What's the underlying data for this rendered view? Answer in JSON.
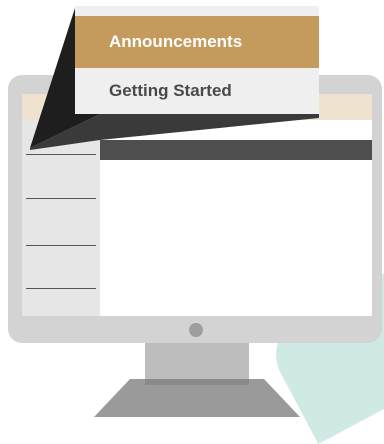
{
  "menu": {
    "items": [
      {
        "label": "Announcements",
        "active": true
      },
      {
        "label": "Getting Started",
        "active": false
      }
    ]
  },
  "colors": {
    "accent": "#c49a5d",
    "menu_bg": "#efefef",
    "monitor": "#d3d3d3",
    "teal": "#cfeae4"
  }
}
